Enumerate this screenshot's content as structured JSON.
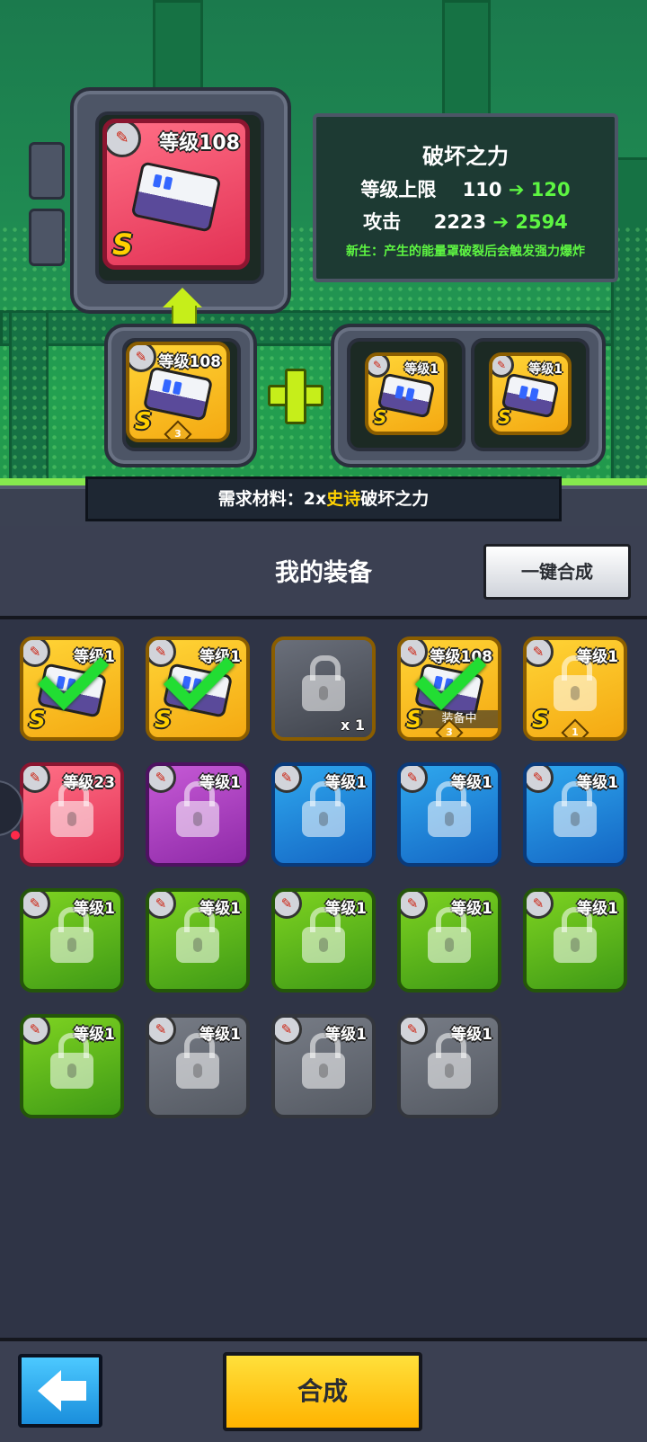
{
  "target": {
    "level": "等级108",
    "rank": "S"
  },
  "info": {
    "title": "破坏之力",
    "cap_label": "等级上限",
    "cap_from": "110",
    "cap_to": "120",
    "atk_label": "攻击",
    "atk_from": "2223",
    "atk_to": "2594",
    "effect": "新生：产生的能量罩破裂后会触发强力爆炸"
  },
  "base": {
    "level": "等级108",
    "rank": "S",
    "stars": "3"
  },
  "materials": [
    {
      "level": "等级1",
      "rank": "S"
    },
    {
      "level": "等级1",
      "rank": "S"
    }
  ],
  "requirement": {
    "prefix": "需求材料：2x",
    "rarity": "史诗",
    "name": "破坏之力"
  },
  "header": {
    "title": "我的装备",
    "one_key_button": "一键合成"
  },
  "inventory": {
    "row1": [
      {
        "level": "等级1",
        "rank": "S"
      },
      {
        "level": "等级1",
        "rank": "S"
      },
      {
        "qty": "x 1"
      },
      {
        "level": "等级108",
        "rank": "S",
        "status": "装备中",
        "stars": "3"
      },
      {
        "level": "等级1",
        "rank": "S",
        "stars": "1"
      }
    ],
    "row2": [
      {
        "level": "等级23"
      },
      {
        "level": "等级1"
      },
      {
        "level": "等级1"
      },
      {
        "level": "等级1"
      },
      {
        "level": "等级1"
      }
    ],
    "row3": [
      {
        "level": "等级1"
      },
      {
        "level": "等级1"
      },
      {
        "level": "等级1"
      },
      {
        "level": "等级1"
      },
      {
        "level": "等级1"
      }
    ],
    "row4": [
      {
        "level": "等级1"
      },
      {
        "level": "等级1"
      },
      {
        "level": "等级1"
      },
      {
        "level": "等级1"
      }
    ]
  },
  "bottom": {
    "merge_button": "合成"
  },
  "colors": {
    "accent_yellow": "#ffc21a",
    "check_green": "#22dd33",
    "back_blue": "#1a8edc"
  }
}
